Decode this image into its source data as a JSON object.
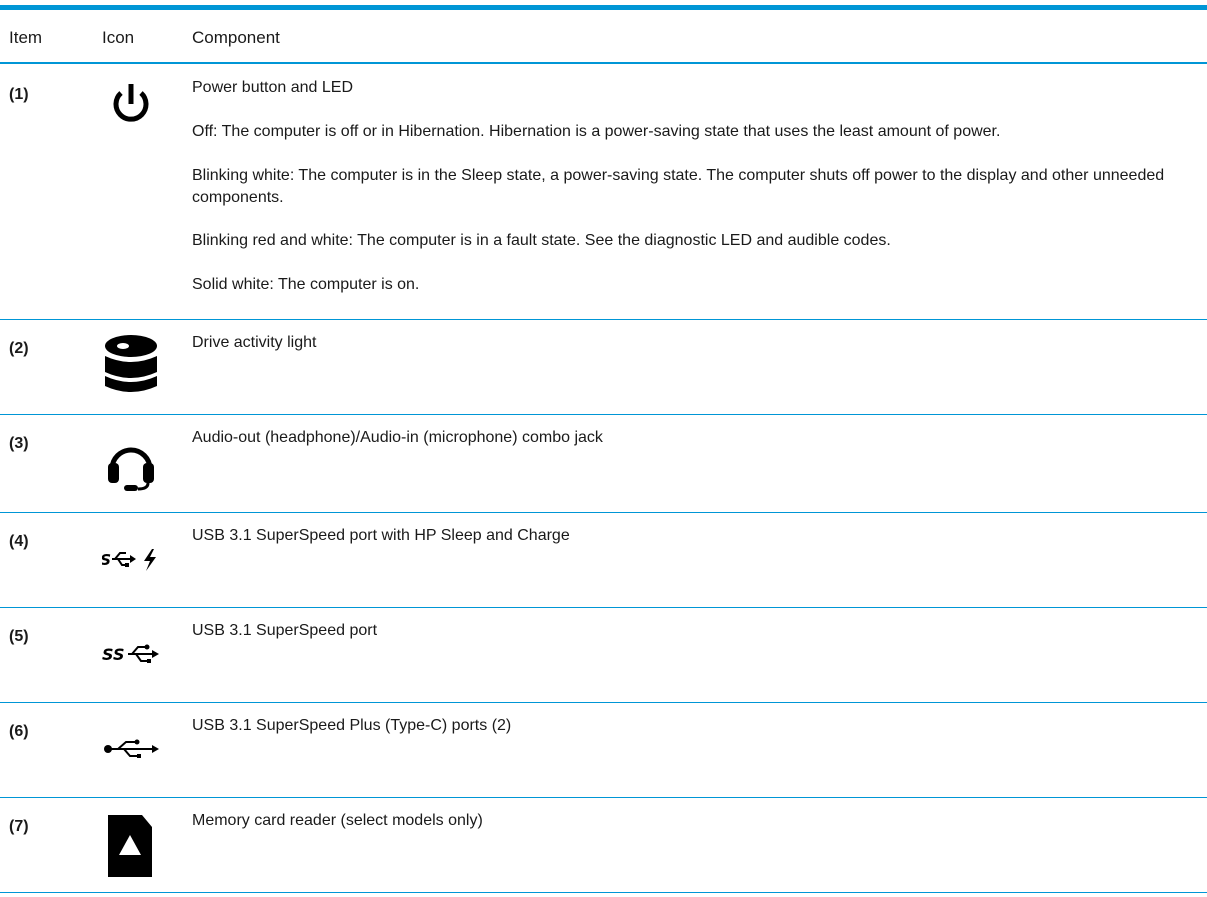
{
  "header": {
    "item": "Item",
    "icon": "Icon",
    "component": "Component"
  },
  "accent_color": "#0096d6",
  "rows": [
    {
      "item": "(1)",
      "icon": "power-icon",
      "paragraphs": [
        "Power button and LED",
        "Off: The computer is off or in Hibernation. Hibernation is a power-saving state that uses the least amount of power.",
        "Blinking white: The computer is in the Sleep state, a power-saving state. The computer shuts off power to the display and other unneeded components.",
        "Blinking red and white: The computer is in a fault state. See the diagnostic LED and audible codes.",
        "Solid white: The computer is on."
      ]
    },
    {
      "item": "(2)",
      "icon": "drive-activity-icon",
      "paragraphs": [
        "Drive activity light"
      ]
    },
    {
      "item": "(3)",
      "icon": "headset-icon",
      "paragraphs": [
        "Audio-out (headphone)/Audio-in (microphone) combo jack"
      ]
    },
    {
      "item": "(4)",
      "icon": "usb-superspeed-charge-icon",
      "paragraphs": [
        "USB 3.1 SuperSpeed port with HP Sleep and Charge"
      ]
    },
    {
      "item": "(5)",
      "icon": "usb-superspeed-icon",
      "paragraphs": [
        "USB 3.1 SuperSpeed port"
      ]
    },
    {
      "item": "(6)",
      "icon": "usb-icon",
      "paragraphs": [
        "USB 3.1 SuperSpeed Plus (Type-C) ports (2)"
      ]
    },
    {
      "item": "(7)",
      "icon": "memory-card-icon",
      "paragraphs": [
        "Memory card reader (select models only)"
      ]
    }
  ]
}
